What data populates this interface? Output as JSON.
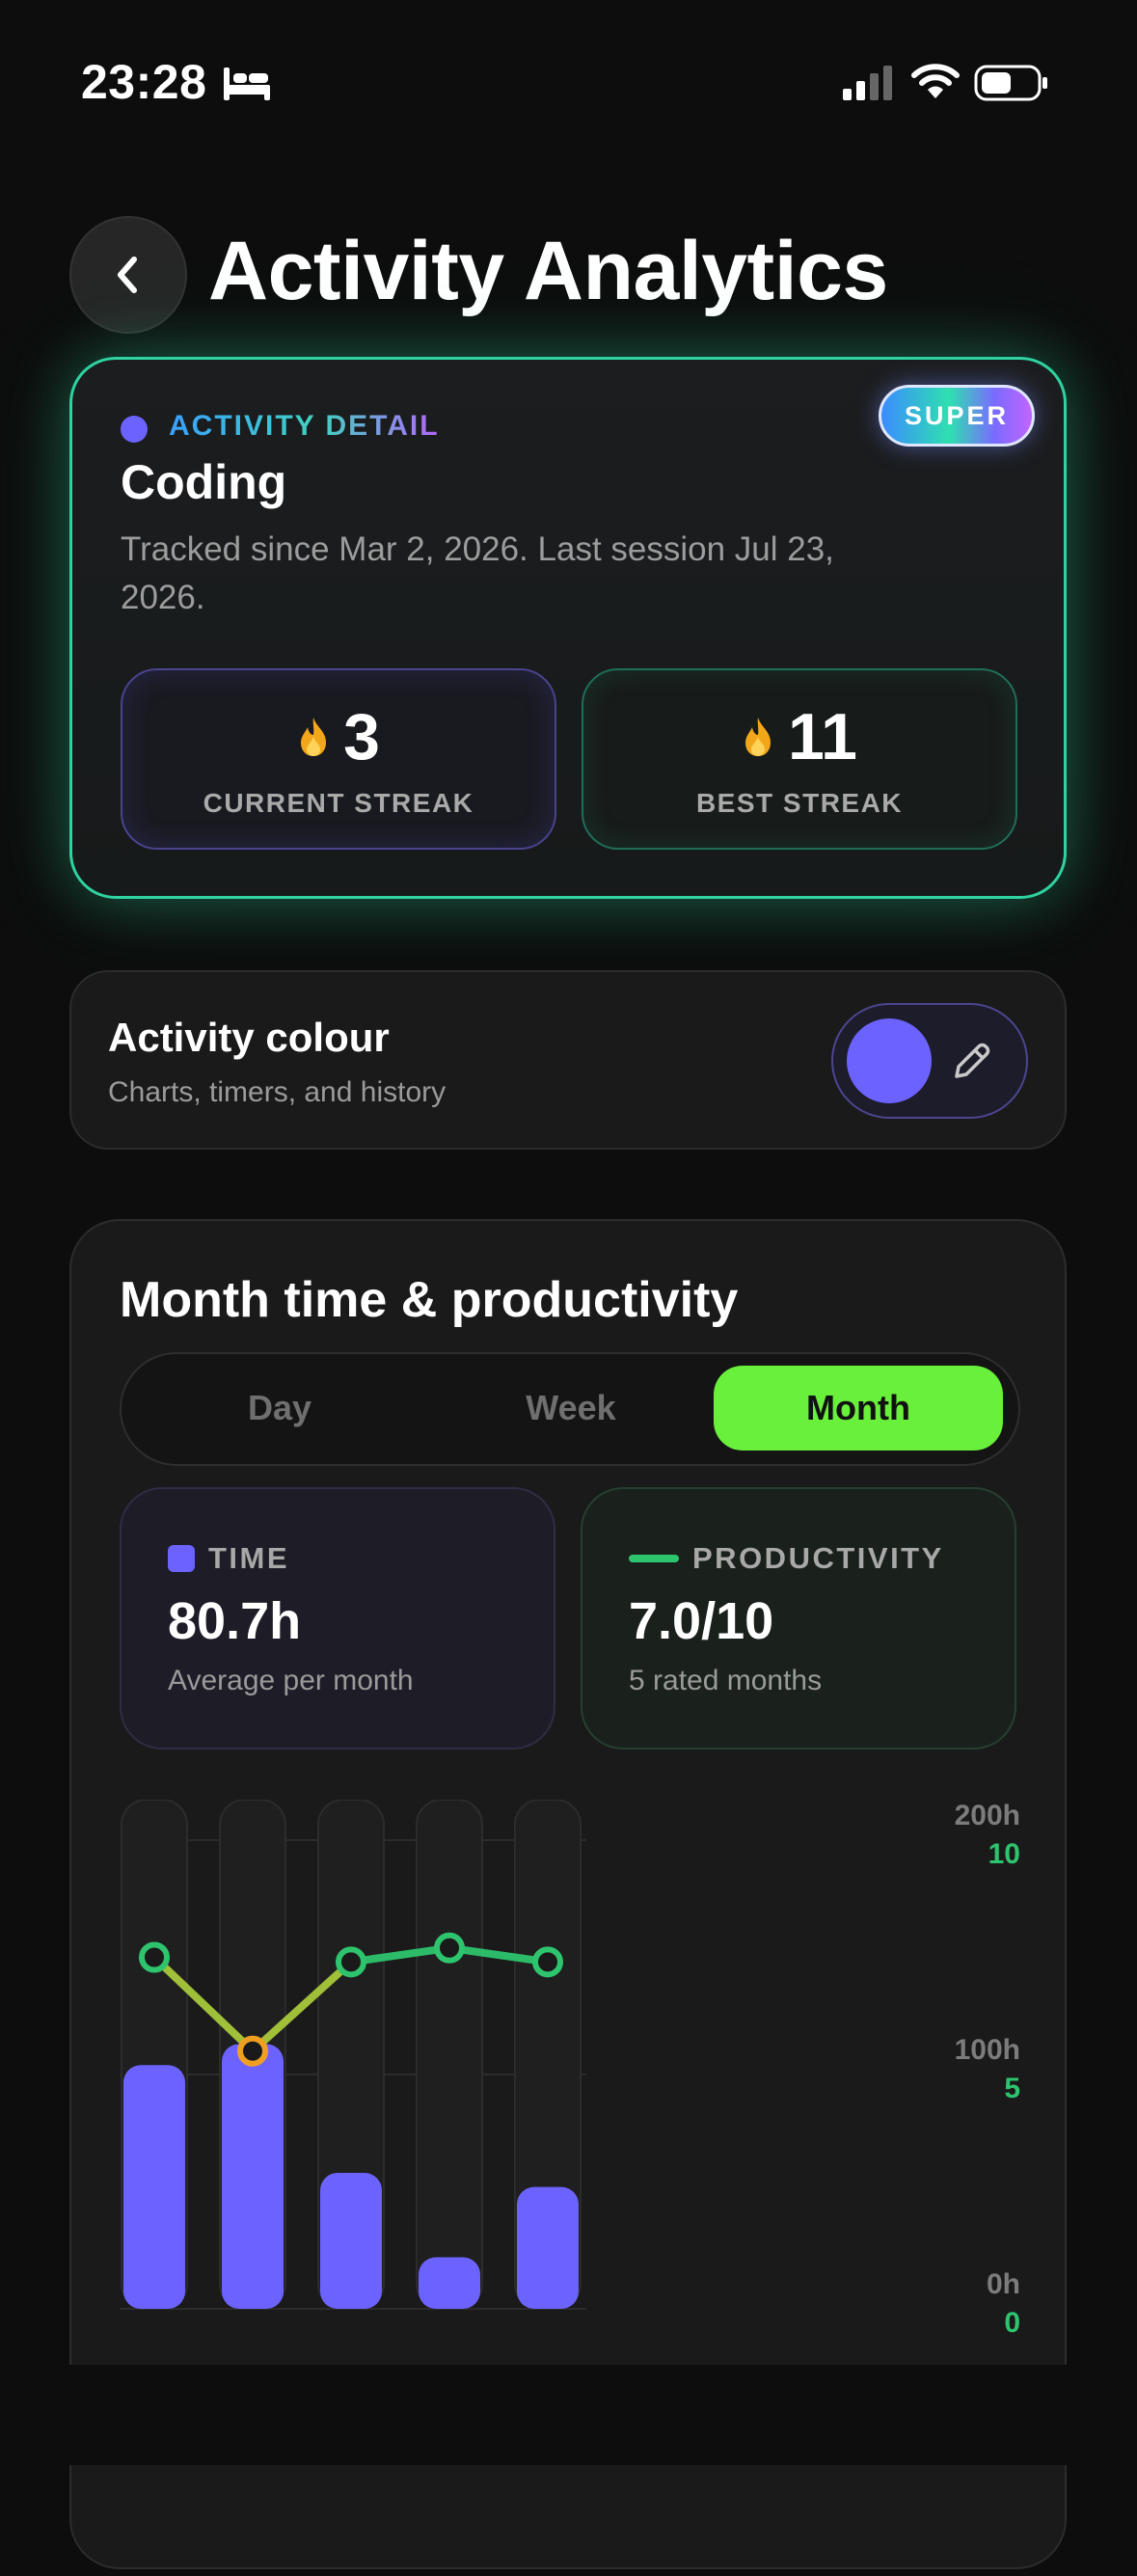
{
  "status_bar": {
    "time": "23:28"
  },
  "header": {
    "title": "Activity Analytics"
  },
  "detail": {
    "eyebrow": "ACTIVITY DETAIL",
    "badge": "SUPER",
    "name": "Coding",
    "tracked": "Tracked since Mar 2, 2026. Last session Jul 23, 2026.",
    "current_streak": {
      "value": "3",
      "label": "CURRENT STREAK"
    },
    "best_streak": {
      "value": "11",
      "label": "BEST STREAK"
    }
  },
  "colour": {
    "title": "Activity colour",
    "subtitle": "Charts, timers, and history",
    "value": "#6C63FF"
  },
  "chart_section": {
    "title": "Month time & productivity",
    "tabs": [
      "Day",
      "Week",
      "Month"
    ],
    "selected_tab": "Month",
    "time_stat": {
      "label": "TIME",
      "value": "80.7h",
      "sub": "Average per month"
    },
    "productivity_stat": {
      "label": "PRODUCTIVITY",
      "value": "7.0/10",
      "sub": "5 rated months"
    }
  },
  "chart_data": {
    "type": "bar",
    "categories": [
      "",
      "",
      "",
      "",
      ""
    ],
    "series": [
      {
        "type": "bar",
        "axis": "hours",
        "values": [
          104,
          113,
          58,
          22,
          52
        ]
      },
      {
        "type": "line",
        "axis": "productivity",
        "values": [
          7.5,
          5.5,
          7.4,
          7.7,
          7.4
        ]
      }
    ],
    "y_left_ticks": [
      "200h",
      "100h",
      "0h"
    ],
    "y_right_ticks": [
      "10",
      "5",
      "0"
    ],
    "ylim_hours": [
      0,
      200
    ],
    "ylim_productivity": [
      0,
      10
    ],
    "low_point_index": 1,
    "colors": {
      "bar": "#6C63FF",
      "line": "#2EC46E",
      "low": "#F0A020"
    }
  }
}
